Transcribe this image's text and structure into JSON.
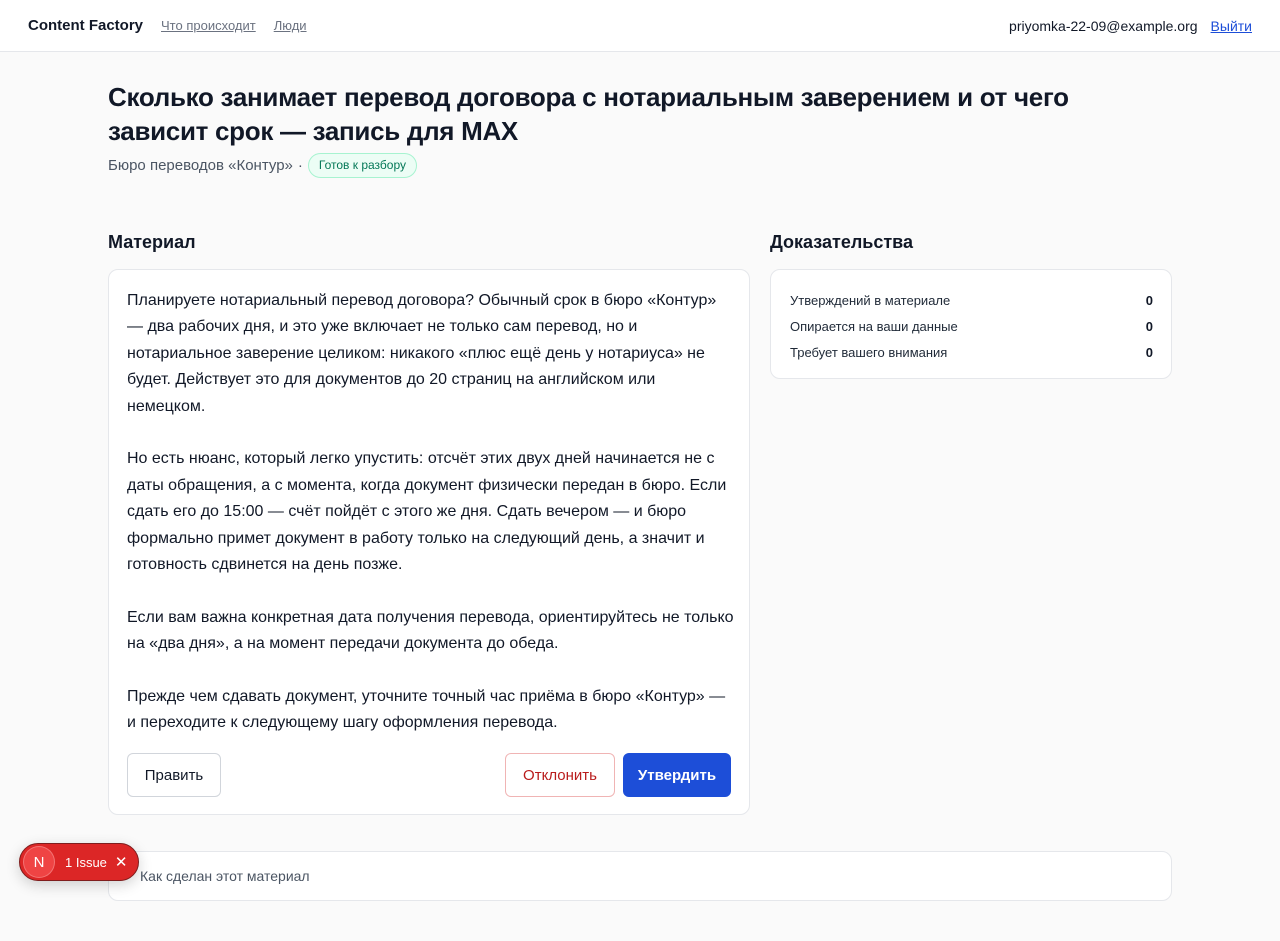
{
  "header": {
    "brand": "Content Factory",
    "nav": [
      "Что происходит",
      "Люди"
    ],
    "user_email": "priyomka-22-09@example.org",
    "logout_label": "Выйти"
  },
  "page": {
    "title": "Сколько занимает перевод договора с нотариальным заверением и от чего зависит срок — запись для MAX",
    "client": "Бюро переводов «Контур»",
    "separator": "·",
    "status_badge": "Готов к разбору",
    "status_color": "#047857"
  },
  "material": {
    "heading": "Материал",
    "paragraphs": [
      "Планируете нотариальный перевод договора? Обычный срок в бюро «Контур» — два рабочих дня, и это уже включает не только сам перевод, но и нотариальное заверение целиком: никакого «плюс ещё день у нотариуса» не будет. Действует это для документов до 20 страниц на английском или немецком.",
      "Но есть нюанс, который легко упустить: отсчёт этих двух дней начинается не с даты обращения, а с момента, когда документ физически передан в бюро. Если сдать его до 15:00 — счёт пойдёт с этого же дня. Сдать вечером — и бюро формально примет документ в работу только на следующий день, а значит и готовность сдвинется на день позже.",
      "Если вам важна конкретная дата получения перевода, ориентируйтесь не только на «два дня», а на момент передачи документа до обеда.",
      "Прежде чем сдавать документ, уточните точный час приёма в бюро «Контур» — и переходите к следующему шагу оформления перевода."
    ],
    "edit_label": "Править",
    "reject_label": "Отклонить",
    "approve_label": "Утвердить",
    "accent_color": "#1d4ed8"
  },
  "evidence": {
    "heading": "Доказательства",
    "rows": [
      {
        "label": "Утверждений в материале",
        "value": "0"
      },
      {
        "label": "Опирается на ваши данные",
        "value": "0"
      },
      {
        "label": "Требует вашего внимания",
        "value": "0"
      }
    ]
  },
  "how_made": {
    "label": "Как сделан этот материал"
  },
  "issue_overlay": {
    "letter": "N",
    "text": "1 Issue",
    "close_icon": "close-icon",
    "color": "#dc2626"
  }
}
